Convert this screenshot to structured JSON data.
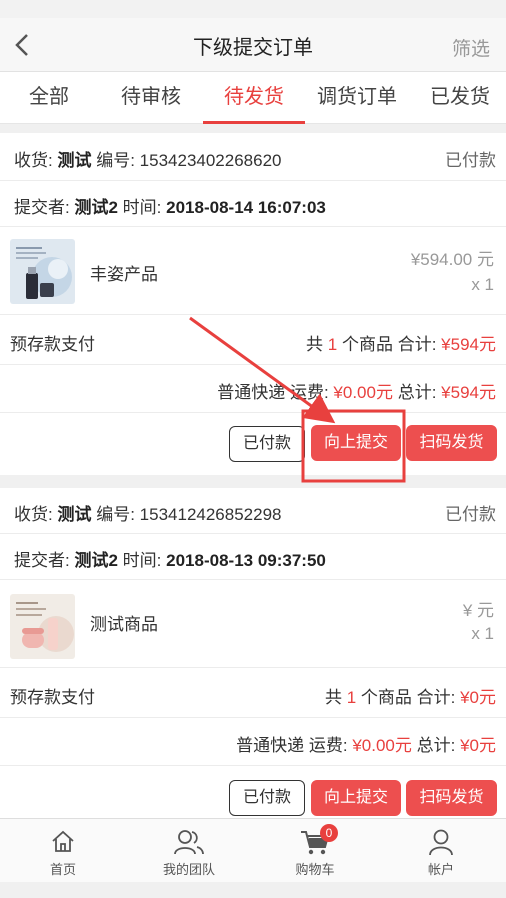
{
  "header": {
    "title": "下级提交订单",
    "filter_label": "筛选"
  },
  "tabs": [
    {
      "label": "全部"
    },
    {
      "label": "待审核"
    },
    {
      "label": "待发货"
    },
    {
      "label": "调货订单"
    },
    {
      "label": "已发货"
    }
  ],
  "active_tab": "待发货",
  "orders": [
    {
      "receiver_label": "收货:",
      "receiver": "测试",
      "number_label": "编号:",
      "number": "153423402268620",
      "status": "已付款",
      "submitter_label": "提交者:",
      "submitter": "测试2",
      "time_label": "时间:",
      "time": "2018-08-14 16:07:03",
      "product_name": "丰姿产品",
      "product_price": "¥594.00 元",
      "product_qty": "x 1",
      "payment": "预存款支付",
      "count_prefix": "共",
      "count": "1",
      "count_suffix": "个商品 合计:",
      "subtotal": "¥594元",
      "shipping_label": "普通快递 运费:",
      "shipping_fee": "¥0.00元",
      "total_label": "总计:",
      "total": "¥594元",
      "btn_paid": "已付款",
      "btn_submit": "向上提交",
      "btn_ship": "扫码发货"
    },
    {
      "receiver_label": "收货:",
      "receiver": "测试",
      "number_label": "编号:",
      "number": "153412426852298",
      "status": "已付款",
      "submitter_label": "提交者:",
      "submitter": "测试2",
      "time_label": "时间:",
      "time": "2018-08-13 09:37:50",
      "product_name": "测试商品",
      "product_price": "¥ 元",
      "product_qty": "x 1",
      "payment": "预存款支付",
      "count_prefix": "共",
      "count": "1",
      "count_suffix": "个商品 合计:",
      "subtotal": "¥0元",
      "shipping_label": "普通快递 运费:",
      "shipping_fee": "¥0.00元",
      "total_label": "总计:",
      "total": "¥0元",
      "btn_paid": "已付款",
      "btn_submit": "向上提交",
      "btn_ship": "扫码发货"
    }
  ],
  "bottom_nav": [
    {
      "label": "首页",
      "icon": "home-icon"
    },
    {
      "label": "我的团队",
      "icon": "team-icon"
    },
    {
      "label": "购物车",
      "icon": "cart-icon",
      "badge": "0"
    },
    {
      "label": "帐户",
      "icon": "user-icon"
    }
  ],
  "colors": {
    "accent": "#e8403e",
    "button_red": "#ed4f4f",
    "annotation": "#e8403e"
  }
}
